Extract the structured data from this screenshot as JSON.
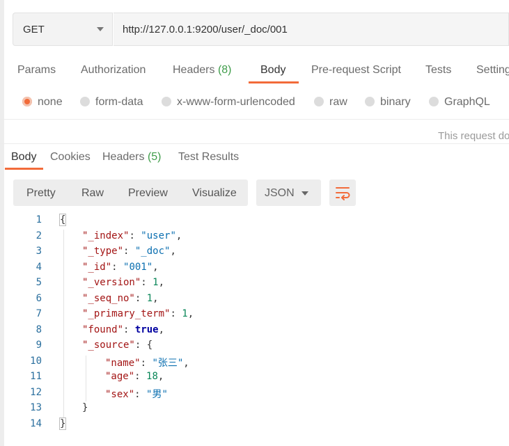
{
  "request": {
    "method": "GET",
    "url": "http://127.0.0.1:9200/user/_doc/001"
  },
  "request_tabs": {
    "params": "Params",
    "authorization": "Authorization",
    "headers": "Headers",
    "headers_count": "(8)",
    "body": "Body",
    "prerequest": "Pre-request Script",
    "tests": "Tests",
    "settings": "Setting"
  },
  "body_types": {
    "none": "none",
    "form_data": "form-data",
    "urlencoded": "x-www-form-urlencoded",
    "raw": "raw",
    "binary": "binary",
    "graphql": "GraphQL",
    "selected": "none"
  },
  "request_note": "This request do",
  "response_tabs": {
    "body": "Body",
    "cookies": "Cookies",
    "headers": "Headers",
    "headers_count": "(5)",
    "test_results": "Test Results"
  },
  "view": {
    "pretty": "Pretty",
    "raw": "Raw",
    "preview": "Preview",
    "visualize": "Visualize",
    "format": "JSON"
  },
  "colors": {
    "accent": "#f26b3a",
    "count": "#3f9d4a"
  },
  "icons": {
    "method_dropdown": "chevron-down-icon",
    "format_dropdown": "chevron-down-icon",
    "wrap": "wrap-lines-icon"
  },
  "code": {
    "line_numbers": [
      "1",
      "2",
      "3",
      "4",
      "5",
      "6",
      "7",
      "8",
      "9",
      "10",
      "11",
      "12",
      "13",
      "14"
    ],
    "open_brace": "{",
    "close_brace": "}",
    "index_key": "\"_index\"",
    "index_val": "\"user\"",
    "type_key": "\"_type\"",
    "type_val": "\"_doc\"",
    "id_key": "\"_id\"",
    "id_val": "\"001\"",
    "version_key": "\"_version\"",
    "version_val": "1",
    "seq_key": "\"_seq_no\"",
    "seq_val": "1",
    "term_key": "\"_primary_term\"",
    "term_val": "1",
    "found_key": "\"found\"",
    "found_val": "true",
    "source_key": "\"_source\"",
    "source_open": "{",
    "name_key": "\"name\"",
    "name_val": "\"张三\"",
    "age_key": "\"age\"",
    "age_val": "18",
    "sex_key": "\"sex\"",
    "sex_val": "\"男\"",
    "source_close": "}"
  }
}
